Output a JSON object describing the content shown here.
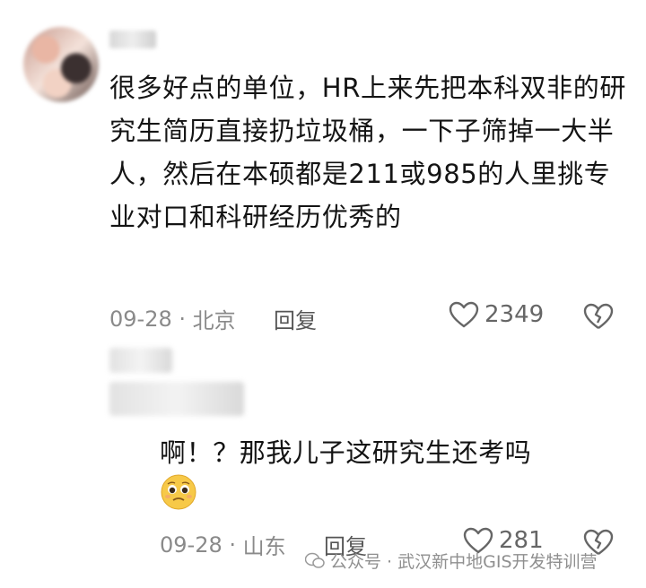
{
  "comment": {
    "text": "很多好点的单位，HR上来先把本科双非的研究生简历直接扔垃圾桶，一下子筛掉一大半人，然后在本硕都是211或985的人里挑专业对口和科研经历优秀的",
    "date": "09-28",
    "location": "北京",
    "reply_label": "回复",
    "likes": "2349"
  },
  "reply": {
    "text": "啊！？那我儿子这研究生还考吗",
    "date": "09-28",
    "location": "山东",
    "reply_label": "回复",
    "likes": "281"
  },
  "watermark": {
    "source": "公众号 · 武汉新中地GIS开发特训营"
  },
  "colors": {
    "text": "#141414",
    "meta": "#8a8a8a",
    "icon": "#666666"
  }
}
